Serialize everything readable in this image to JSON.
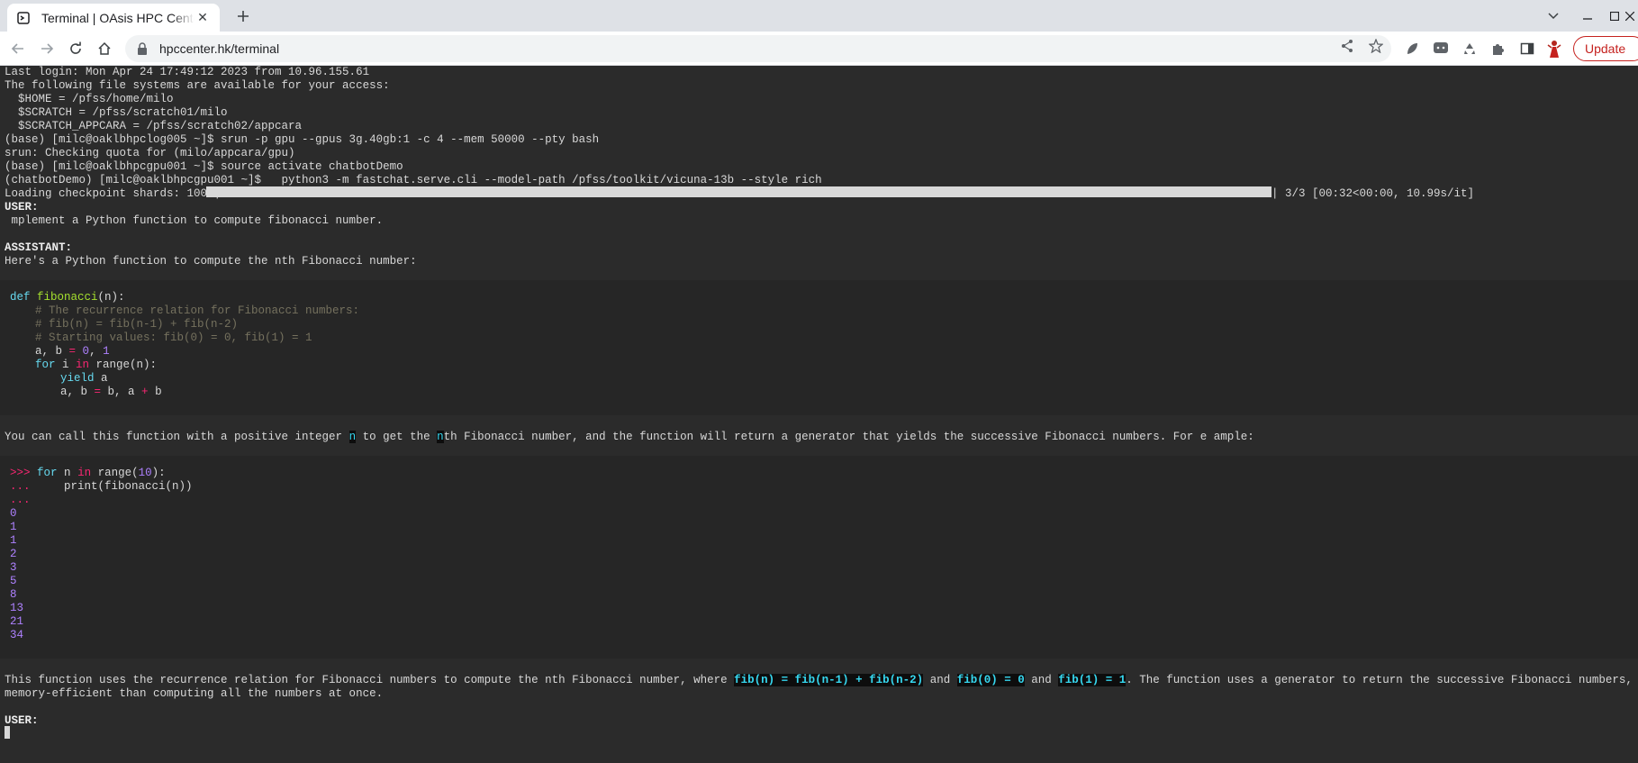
{
  "browser": {
    "tab_title": "Terminal | OAsis HPC Center",
    "url": "hpccenter.hk/terminal",
    "update_label": "Update"
  },
  "terminal": {
    "lines": [
      "Last login: Mon Apr 24 17:49:12 2023 from 10.96.155.61",
      "The following file systems are available for your access:",
      "  $HOME = /pfss/home/milo",
      "  $SCRATCH = /pfss/scratch01/milo",
      "  $SCRATCH_APPCARA = /pfss/scratch02/appcara",
      "(base) [milc@oaklbhpclog005 ~]$ srun -p gpu --gpus 3g.40gb:1 -c 4 --mem 50000 --pty bash",
      "srun: Checking quota for (milo/appcara/gpu)",
      "(base) [milc@oaklbhpcgpu001 ~]$ source activate chatbotDemo",
      "(chatbotDemo) [milc@oaklbhpcgpu001 ~]$   python3 -m fastchat.serve.cli --model-path /pfss/toolkit/vicuna-13b --style rich"
    ],
    "progress": {
      "label": "Loading checkpoint shards: 100%|",
      "percent": 100,
      "suffix": "| 3/3 [00:32<00:00, 10.99s/it]"
    },
    "user_label": "USER:",
    "user_message": " mplement a Python function to compute fibonacci number.",
    "assistant_label": "ASSISTANT:",
    "assistant_intro": "Here's a Python function to compute the nth Fibonacci number:",
    "code1": {
      "def": "def",
      "fname": "fibonacci",
      "sig_rest": "(n):",
      "comment1": "# The recurrence relation for Fibonacci numbers:",
      "comment2": "# fib(n) = fib(n-1) + fib(n-2)",
      "comment3": "# Starting values: fib(0) = 0, fib(1) = 1",
      "assign_lhs": "a, b ",
      "eq": "=",
      "zero": "0",
      "comma": ", ",
      "one": "1",
      "for": "for",
      "i": " i ",
      "in": "in",
      "range": " range(n):",
      "yield": "yield",
      "yield_rest": " a",
      "update_lhs": "a, b ",
      "update_rhs": " b, a ",
      "plus": "+",
      "update_end": " b"
    },
    "explain": {
      "part1": "You can call this function with a positive integer ",
      "n1": "n",
      "part2": " to get the ",
      "n2": "n",
      "part3": "th Fibonacci number, and the function will return a generator that yields the successive Fibonacci numbers. For e ample:"
    },
    "code2": {
      "prompt1": ">>>",
      "for": "for",
      "n": " n ",
      "in": "in",
      "range_open": " range(",
      "ten": "10",
      "range_close": "):",
      "cont1": "...",
      "print": "     print(fibonacci(n))",
      "cont2": "...",
      "outputs": [
        "0",
        "1",
        "1",
        "2",
        "3",
        "5",
        "8",
        "13",
        "21",
        "34"
      ]
    },
    "summary": {
      "p1": "This function uses the recurrence relation for Fibonacci numbers to compute the nth Fibonacci number, where ",
      "c1": "fib(n) = fib(n-1) + fib(n-2)",
      "p2": " and ",
      "c2": "fib(0) = 0",
      "p3": " and ",
      "c3": "fib(1) = 1",
      "p4": ". The function uses a generator to return the successive Fibonacci numbers, which can be more",
      "line2": "memory-efficient than computing all the numbers at once."
    },
    "user_label2": "USER:"
  }
}
